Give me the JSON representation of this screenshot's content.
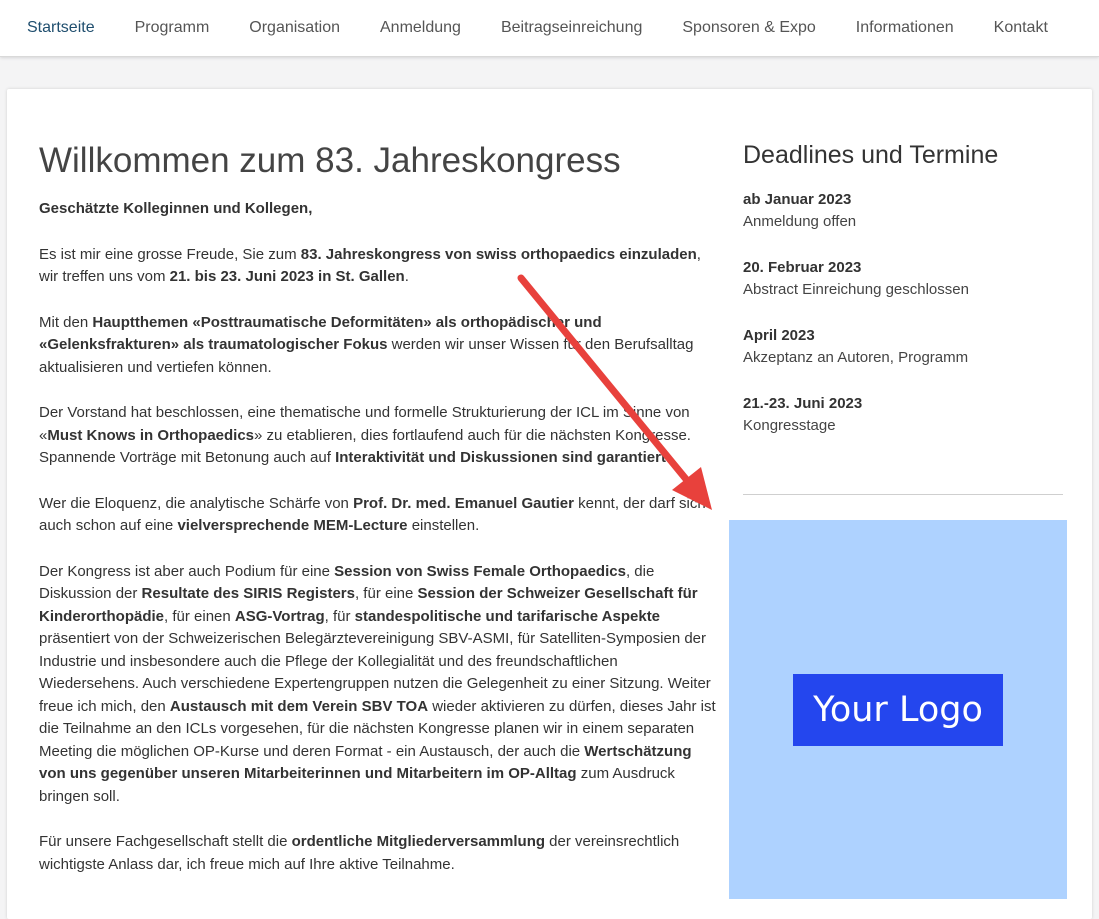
{
  "nav": {
    "items": [
      {
        "label": "Startseite",
        "active": true
      },
      {
        "label": "Programm"
      },
      {
        "label": "Organisation"
      },
      {
        "label": "Anmeldung"
      },
      {
        "label": "Beitragseinreichung"
      },
      {
        "label": "Sponsoren & Expo"
      },
      {
        "label": "Informationen"
      },
      {
        "label": "Kontakt"
      }
    ]
  },
  "main": {
    "title": "Willkommen zum 83. Jahreskongress",
    "paragraphs": [
      [
        {
          "b": "Geschätzte Kolleginnen und Kollegen,"
        }
      ],
      [
        "Es ist mir eine grosse Freude, Sie zum ",
        {
          "b": "83. Jahreskongress von swiss orthopaedics einzuladen"
        },
        ", wir treffen uns vom ",
        {
          "b": "21. bis 23. Juni 2023 in St. Gallen"
        },
        "."
      ],
      [
        "Mit den ",
        {
          "b": "Hauptthemen «Posttraumatische Deformitäten» als orthopädischer und «Gelenksfrakturen» als traumatologischer Fokus"
        },
        " werden wir unser Wissen für den Berufsalltag aktualisieren und vertiefen können."
      ],
      [
        "Der Vorstand hat beschlossen, eine thematische und formelle Strukturierung der ICL im Sinne von «",
        {
          "b": "Must Knows in Orthopaedics"
        },
        "» zu etablieren, dies fortlaufend auch für die nächsten Kongresse. Spannende Vorträge mit Betonung auch auf ",
        {
          "b": "Interaktivität und Diskussionen sind garantiert"
        },
        "."
      ],
      [
        "Wer die Eloquenz, die analytische Schärfe von ",
        {
          "b": "Prof. Dr. med. Emanuel Gautier"
        },
        " kennt, der darf sich auch schon auf eine ",
        {
          "b": "vielversprechende MEM-Lecture"
        },
        " einstellen."
      ],
      [
        "Der Kongress ist aber auch Podium für eine ",
        {
          "b": "Session von Swiss Female Orthopaedics"
        },
        ", die Diskussion der ",
        {
          "b": "Resultate des SIRIS Registers"
        },
        ", für eine ",
        {
          "b": "Session der Schweizer Gesellschaft für Kinderorthopädie"
        },
        ", für einen ",
        {
          "b": "ASG-Vortrag"
        },
        ", für ",
        {
          "b": "standespolitische und tarifarische Aspekte"
        },
        " präsentiert von der Schweizerischen Belegärztevereinigung SBV-ASMI, für Satelliten-Symposien der Industrie und insbesondere auch die Pflege der Kollegialität und des freundschaftlichen Wiedersehens. Auch verschiedene Expertengruppen nutzen die Gelegenheit zu einer Sitzung. Weiter freue ich mich, den ",
        {
          "b": "Austausch mit dem Verein SBV TOA"
        },
        " wieder aktivieren zu dürfen, dieses Jahr ist die Teilnahme an den ICLs vorgesehen, für die nächsten Kongresse planen wir in einem separaten Meeting die möglichen OP-Kurse und deren Format - ein Austausch, der auch die ",
        {
          "b": "Wertschätzung von uns gegenüber unseren Mitarbeiterinnen und Mitarbeitern im OP-Alltag"
        },
        " zum Ausdruck bringen soll."
      ],
      [
        "Für unsere Fachgesellschaft stellt die ",
        {
          "b": "ordentliche Mitgliederversammlung"
        },
        " der vereinsrechtlich wichtigste Anlass dar, ich freue mich auf Ihre aktive Teilnahme."
      ]
    ]
  },
  "sidebar": {
    "title": "Deadlines und Termine",
    "deadlines": [
      {
        "date": "ab Januar 2023",
        "text": "Anmeldung offen"
      },
      {
        "date": "20. Februar 2023",
        "text": "Abstract Einreichung geschlossen"
      },
      {
        "date": "April 2023",
        "text": "Akzeptanz an Autoren, Programm"
      },
      {
        "date": "21.-23. Juni 2023",
        "text": "Kongresstage"
      }
    ],
    "logo_text": "Your Logo"
  },
  "colors": {
    "arrow": "#e8413c",
    "logo_bg": "#aed2ff",
    "logo_badge": "#2446ee",
    "nav_active": "#1f4e6e"
  }
}
